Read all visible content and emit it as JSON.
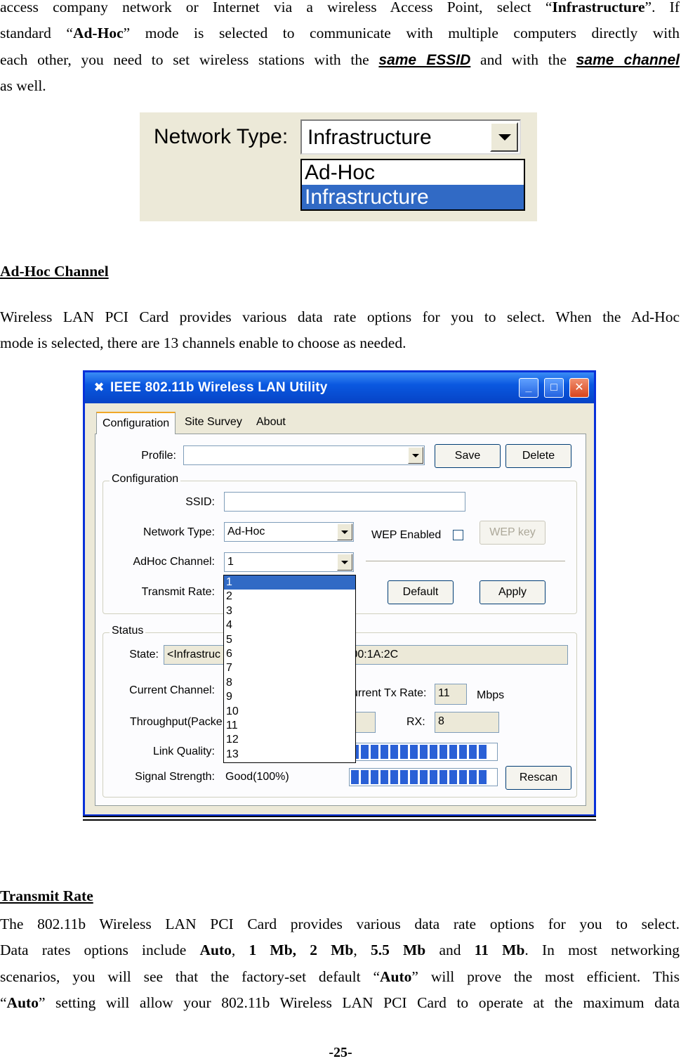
{
  "intro": {
    "line1": [
      "access company network or Internet via a wireless Access Point, select “",
      "Infrastructure",
      "”. If"
    ],
    "line2": [
      "standard “",
      "Ad-Hoc",
      "” mode is selected to communicate with multiple computers directly with"
    ],
    "line3": [
      "each other, you need to set wireless stations with the ",
      "same ESSID",
      " and with the ",
      "same channel"
    ],
    "line4": "as well."
  },
  "network_type_image": {
    "label": "Network Type:",
    "selected": "Infrastructure",
    "options": [
      "Ad-Hoc",
      "Infrastructure"
    ],
    "highlighted": "Infrastructure"
  },
  "adhoc_section": {
    "heading": "Ad-Hoc Channel",
    "line1": "Wireless LAN PCI Card provides various data rate options for you to select. When the Ad-Hoc",
    "line2": "mode is selected, there are 13 channels enable to choose as needed."
  },
  "utility": {
    "title": "IEEE 802.11b Wireless LAN Utility",
    "tabs": [
      "Configuration",
      "Site Survey",
      "About"
    ],
    "profile_label": "Profile:",
    "profile_value": "",
    "save": "Save",
    "delete": "Delete",
    "config_group": "Configuration",
    "ssid_label": "SSID:",
    "ssid_value": "",
    "network_type_label": "Network Type:",
    "network_type_value": "Ad-Hoc",
    "wep_enabled": "WEP Enabled",
    "wep_key": "WEP key",
    "adhoc_channel_label": "AdHoc Channel:",
    "adhoc_channel_value": "1",
    "transmit_rate_label": "Transmit Rate:",
    "default": "Default",
    "apply": "Apply",
    "status_group": "Status",
    "state_label": "State:",
    "state_value": "<Infrastruc",
    "mac_partial": ":00:1A:2C",
    "current_channel_label": "Current Channel:",
    "tx_rate_label": "urrent Tx Rate:",
    "tx_rate_value": "11",
    "tx_rate_unit": "Mbps",
    "throughput_label": "Throughput(Packe",
    "rx_label": "RX:",
    "rx_value": "8",
    "link_quality_label": "Link Quality:",
    "signal_strength_label": "Signal Strength:",
    "signal_strength_value": "Good(100%)",
    "rescan": "Rescan",
    "channels": [
      "1",
      "2",
      "3",
      "4",
      "5",
      "6",
      "7",
      "8",
      "9",
      "10",
      "11",
      "12",
      "13"
    ],
    "highlighted_channel": "1"
  },
  "transmit_section": {
    "heading": "Transmit Rate",
    "line1": "The 802.11b Wireless LAN PCI Card provides various data rate options for you to select.",
    "line2": [
      "Data rates options include ",
      "Auto",
      ", ",
      "1 Mb, 2 Mb",
      ", ",
      "5.5 Mb",
      " and ",
      "11 Mb",
      ".  In most networking"
    ],
    "line3": [
      "scenarios, you will see that the factory-set default “",
      "Auto",
      "” will prove the most efficient.   This"
    ],
    "line4": [
      "“",
      "Auto",
      "” setting will allow your 802.11b Wireless LAN PCI Card to operate at the maximum data"
    ]
  },
  "page_number": "-25-"
}
